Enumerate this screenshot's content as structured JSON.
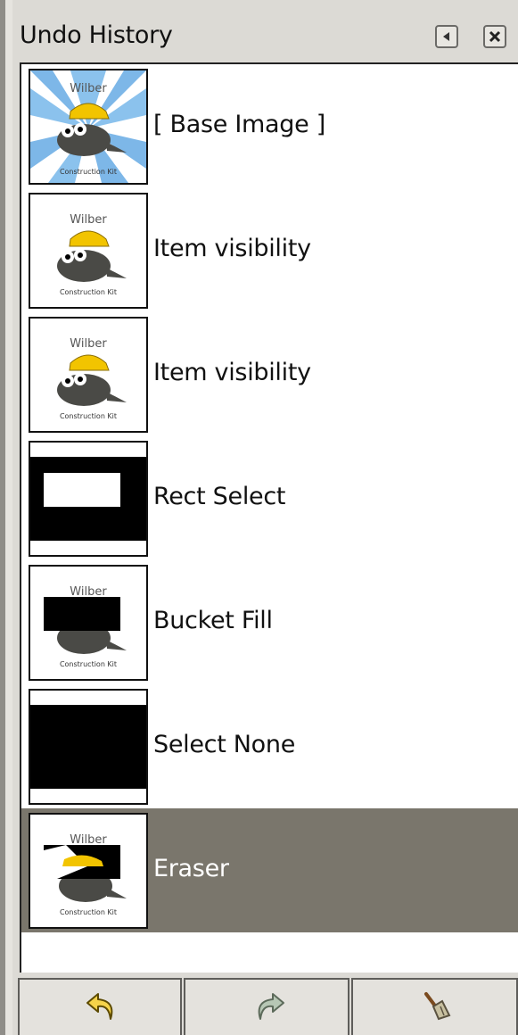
{
  "panel": {
    "title": "Undo History",
    "detach_icon": "tab-menu-icon",
    "close_icon": "close-icon"
  },
  "thumbnail_text": {
    "top": "Wilber",
    "bottom": "Construction Kit"
  },
  "history": [
    {
      "label": "[ Base Image ]",
      "thumb": "wilber-full",
      "selected": false
    },
    {
      "label": "Item visibility",
      "thumb": "wilber-plain",
      "selected": false
    },
    {
      "label": "Item visibility",
      "thumb": "wilber-plain",
      "selected": false
    },
    {
      "label": "Rect Select",
      "thumb": "black-with-white-rect",
      "selected": false
    },
    {
      "label": "Bucket Fill",
      "thumb": "wilber-black-rect",
      "selected": false
    },
    {
      "label": "Select None",
      "thumb": "black-fill",
      "selected": false
    },
    {
      "label": "Eraser",
      "thumb": "wilber-erased",
      "selected": true
    }
  ],
  "toolbar": {
    "undo_icon": "undo-arrow-icon",
    "redo_icon": "redo-arrow-icon",
    "clear_icon": "clear-history-broom-icon"
  },
  "colors": {
    "selected_row": "#7a766c",
    "background": "#dcdad5"
  }
}
